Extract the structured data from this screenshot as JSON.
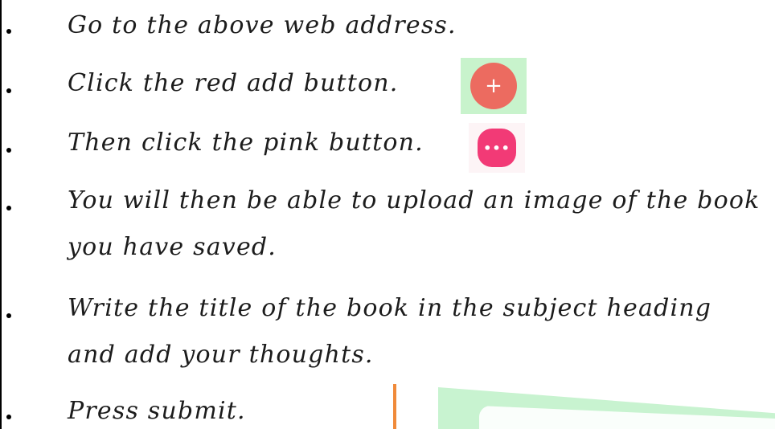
{
  "instructions": [
    {
      "lines": [
        "Go to the above web address."
      ]
    },
    {
      "lines": [
        "Click the red add button."
      ]
    },
    {
      "lines": [
        "Then click the pink button."
      ]
    },
    {
      "lines": [
        "You will then be able to upload an image of the book",
        "you have saved."
      ]
    },
    {
      "lines": [
        "Write the title of the book in the subject heading",
        "and add your thoughts."
      ]
    },
    {
      "lines": [
        "Press submit."
      ]
    }
  ],
  "icons": {
    "add_button_glyph": "+",
    "more_button_glyph": "•••",
    "add_icon": "plus-circle-icon",
    "more_icon": "more-dots-icon"
  },
  "colors": {
    "add_red": "#ec6b60",
    "add_bg_green": "#c8f3cc",
    "more_pink": "#f23a76",
    "orange_accent": "#f08a3a",
    "green_accent": "#c8f3d0"
  }
}
